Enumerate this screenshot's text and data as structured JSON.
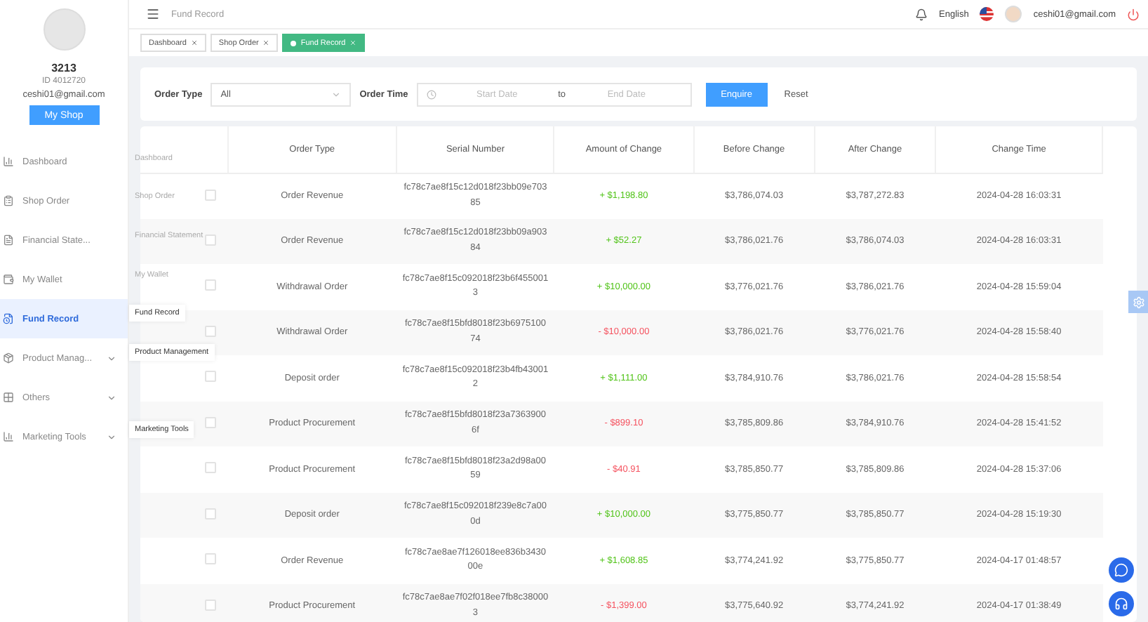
{
  "profile": {
    "name": "3213",
    "id": "ID 4012720",
    "email": "ceshi01@gmail.com",
    "button": "My Shop"
  },
  "sidebar": {
    "items": [
      {
        "label": "Dashboard",
        "selected": false,
        "expandable": false
      },
      {
        "label": "Shop Order",
        "selected": false,
        "expandable": false
      },
      {
        "label": "Financial State...",
        "selected": false,
        "expandable": false
      },
      {
        "label": "My Wallet",
        "selected": false,
        "expandable": false
      },
      {
        "label": "Fund Record",
        "selected": true,
        "expandable": false
      },
      {
        "label": "Product Manag...",
        "selected": false,
        "expandable": true
      },
      {
        "label": "Others",
        "selected": false,
        "expandable": true
      },
      {
        "label": "Marketing Tools",
        "selected": false,
        "expandable": true
      }
    ]
  },
  "header": {
    "breadcrumb": "Fund Record",
    "language": "English",
    "user_email": "ceshi01@gmail.com"
  },
  "tabs": [
    {
      "label": "Dashboard",
      "selected": false
    },
    {
      "label": "Shop Order",
      "selected": false
    },
    {
      "label": "Fund Record",
      "selected": true
    }
  ],
  "filter": {
    "order_type_label": "Order Type",
    "order_type_value": "All",
    "order_time_label": "Order Time",
    "start_placeholder": "Start Date",
    "separator": "to",
    "end_placeholder": "End Date",
    "enquire": "Enquire",
    "reset": "Reset"
  },
  "tooltips": [
    {
      "label": "Dashboard",
      "kind": "faint"
    },
    {
      "label": "Shop Order",
      "kind": "faint"
    },
    {
      "label": "Financial Statement",
      "kind": "faint"
    },
    {
      "label": "My Wallet",
      "kind": "faint"
    },
    {
      "label": "Fund Record",
      "kind": "raised"
    },
    {
      "label": "Product Management",
      "kind": "raised"
    },
    {
      "label": "Marketing Tools",
      "kind": "raised"
    }
  ],
  "table": {
    "columns": [
      "Order Type",
      "Serial Number",
      "Amount of Change",
      "Before Change",
      "After Change",
      "Change Time"
    ],
    "rows": [
      {
        "checked": false,
        "type": "Order Revenue",
        "serial": "fc78c7ae8f15c12d018f23bb09e70385",
        "amount": "+ $1,198.80",
        "kind": "gain",
        "before": "$3,786,074.03",
        "after": "$3,787,272.83",
        "time": "2024-04-28 16:03:31"
      },
      {
        "checked": false,
        "type": "Order Revenue",
        "serial": "fc78c7ae8f15c12d018f23bb09a90384",
        "amount": "+ $52.27",
        "kind": "gain",
        "before": "$3,786,021.76",
        "after": "$3,786,074.03",
        "time": "2024-04-28 16:03:31"
      },
      {
        "checked": false,
        "type": "Withdrawal Order",
        "serial": "fc78c7ae8f15c092018f23b6f4550013",
        "amount": "+ $10,000.00",
        "kind": "gain",
        "before": "$3,776,021.76",
        "after": "$3,786,021.76",
        "time": "2024-04-28 15:59:04"
      },
      {
        "checked": false,
        "type": "Withdrawal Order",
        "serial": "fc78c7ae8f15bfd8018f23b697510074",
        "amount": "- $10,000.00",
        "kind": "loss",
        "before": "$3,786,021.76",
        "after": "$3,776,021.76",
        "time": "2024-04-28 15:58:40"
      },
      {
        "checked": false,
        "type": "Deposit order",
        "serial": "fc78c7ae8f15c092018f23b4fb430012",
        "amount": "+ $1,111.00",
        "kind": "gain",
        "before": "$3,784,910.76",
        "after": "$3,786,021.76",
        "time": "2024-04-28 15:58:54"
      },
      {
        "checked": false,
        "type": "Product Procurement",
        "serial": "fc78c7ae8f15bfd8018f23a73639006f",
        "amount": "- $899.10",
        "kind": "loss",
        "before": "$3,785,809.86",
        "after": "$3,784,910.76",
        "time": "2024-04-28 15:41:52"
      },
      {
        "checked": false,
        "type": "Product Procurement",
        "serial": "fc78c7ae8f15bfd8018f23a2d98a0059",
        "amount": "- $40.91",
        "kind": "loss",
        "before": "$3,785,850.77",
        "after": "$3,785,809.86",
        "time": "2024-04-28 15:37:06"
      },
      {
        "checked": false,
        "type": "Deposit order",
        "serial": "fc78c7ae8f15c092018f239e8c7a000d",
        "amount": "+ $10,000.00",
        "kind": "gain",
        "before": "$3,775,850.77",
        "after": "$3,785,850.77",
        "time": "2024-04-28 15:19:30"
      },
      {
        "checked": false,
        "type": "Order Revenue",
        "serial": "fc78c7ae8ae7f126018ee836b343000e",
        "amount": "+ $1,608.85",
        "kind": "gain",
        "before": "$3,774,241.92",
        "after": "$3,775,850.77",
        "time": "2024-04-17 01:48:57"
      },
      {
        "checked": false,
        "type": "Product Procurement",
        "serial": "fc78c7ae8ae7f02f018ee7fb8c380003",
        "amount": "- $1,399.00",
        "kind": "loss",
        "before": "$3,775,640.92",
        "after": "$3,774,241.92",
        "time": "2024-04-17 01:38:49"
      }
    ]
  }
}
